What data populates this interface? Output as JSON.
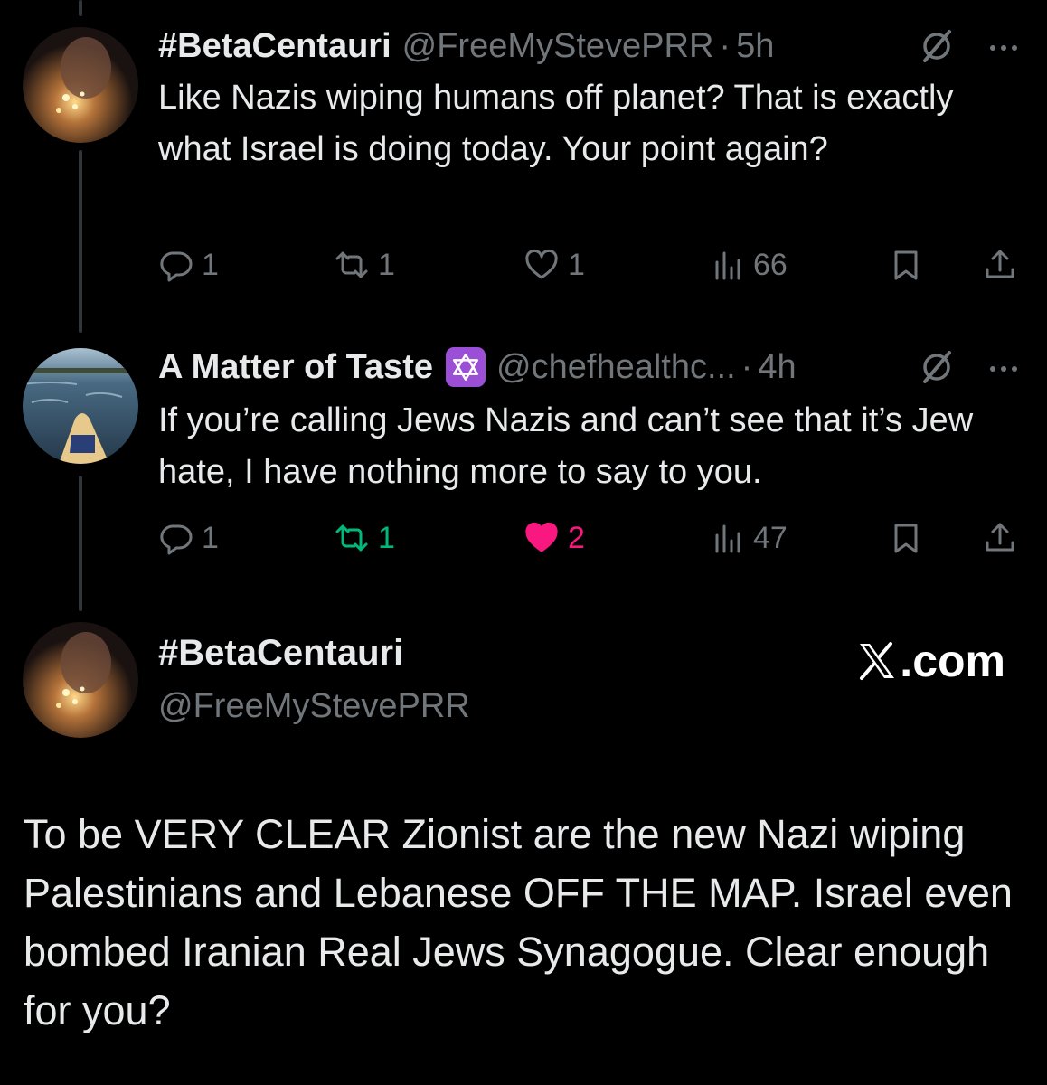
{
  "tweets": [
    {
      "display_name": "#BetaCentauri",
      "handle": "@FreeMyStevePRR",
      "time": "5h",
      "text": "Like Nazis wiping humans off planet? That is exactly what Israel is doing today. Your point again?",
      "replies": "1",
      "retweets": "1",
      "likes": "1",
      "views": "66",
      "retweeted": false,
      "liked": false
    },
    {
      "display_name": "A Matter of Taste",
      "badge_emoji": "✡",
      "handle": "@chefhealthc...",
      "time": "4h",
      "text": "If you’re calling Jews Nazis and can’t see that it’s Jew hate, I have nothing more to say to you.",
      "replies": "1",
      "retweets": "1",
      "likes": "2",
      "views": "47",
      "retweeted": true,
      "liked": true
    }
  ],
  "focused_tweet": {
    "display_name": "#BetaCentauri",
    "handle": "@FreeMyStevePRR",
    "text": "To be VERY CLEAR Zionist are the new Nazi wiping Palestinians and Lebanese OFF THE MAP. Israel even bombed Iranian Real Jews Synagogue. Clear enough for you?"
  },
  "watermark": ".com",
  "colors": {
    "background": "#000000",
    "text": "#e7e9ea",
    "secondary": "#71767b",
    "retweet_active": "#00ba7c",
    "like_active": "#f91880"
  },
  "icons": [
    "reply-icon",
    "retweet-icon",
    "like-icon",
    "views-icon",
    "bookmark-icon",
    "share-icon",
    "grok-icon",
    "more-icon",
    "x-logo-icon"
  ]
}
